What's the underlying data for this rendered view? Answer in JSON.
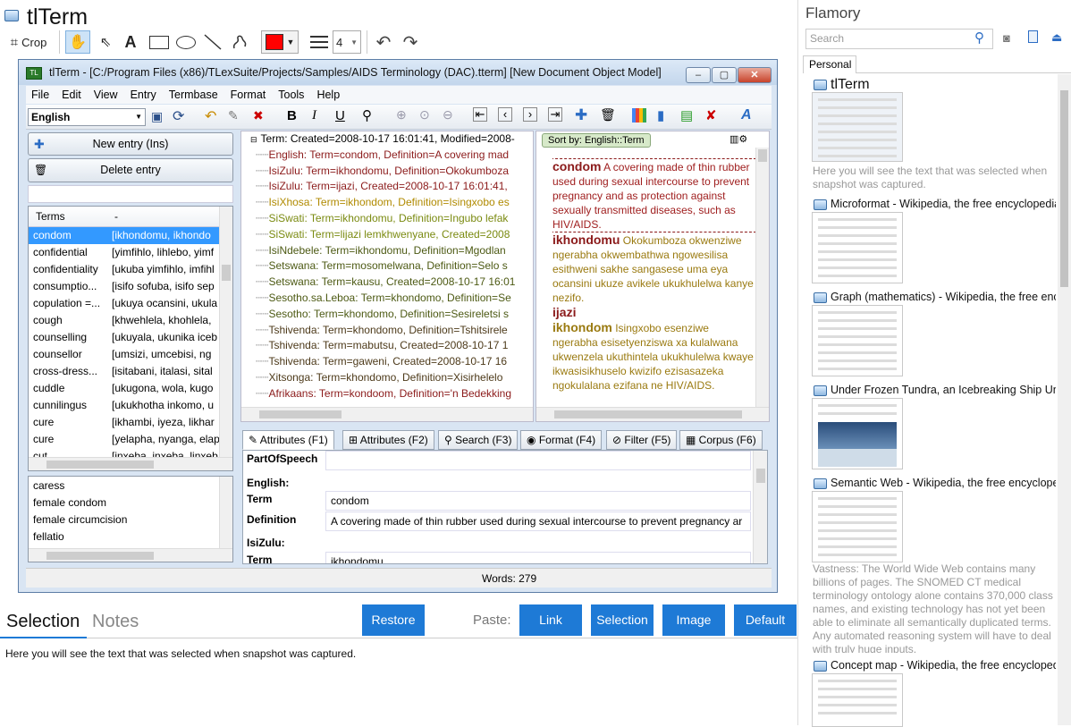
{
  "left": {
    "app_title": "tlTerm",
    "toolbar": {
      "crop_label": "Crop",
      "line_width_value": "4"
    }
  },
  "window": {
    "title": "tlTerm - [C:/Program Files (x86)/TLexSuite/Projects/Samples/AIDS Terminology (DAC).tterm] [New Document Object Model]",
    "menu": [
      "File",
      "Edit",
      "View",
      "Entry",
      "Termbase",
      "Format",
      "Tools",
      "Help"
    ],
    "language_select": "English",
    "new_entry": "New entry (Ins)",
    "delete_entry": "Delete entry",
    "terms_header": [
      "Terms",
      "-"
    ],
    "terms": [
      [
        "condom",
        "[ikhondomu, ikhondo"
      ],
      [
        "confidential",
        "[yimfihlo, lihlebo, yimf"
      ],
      [
        "confidentiality",
        "[ukuba yimfihlo, imfihl"
      ],
      [
        "consumptio...",
        "[isifo sofuba, isifo sep"
      ],
      [
        "copulation =...",
        "[ukuya ocansini, ukula"
      ],
      [
        "cough",
        "[khwehlela, khohlela,"
      ],
      [
        "counselling",
        "[ukuyala, ukunika iceb"
      ],
      [
        "counsellor",
        "[umsizi, umcebisi, ng"
      ],
      [
        "cross-dress...",
        "[isitabani, italasi, sital"
      ],
      [
        "cuddle",
        "[ukugona, wola, kugo"
      ],
      [
        "cunnilingus",
        "[ukukhotha inkomo, u"
      ],
      [
        "cure",
        "[ikhambi, iyeza, likhar"
      ],
      [
        "cure",
        "[yelapha, nyanga, elap"
      ],
      [
        "cut",
        "[inxeba, inxeba, linxeb"
      ]
    ],
    "related_terms": [
      "caress",
      "female condom",
      "female circumcision",
      "fellatio"
    ],
    "tree_root": "Term:  Created=2008-10-17 16:01:41, Modified=2008-",
    "tree_rows": [
      {
        "text": "English:  Term=condom, Definition=A covering mad",
        "color": "#8b1a1a"
      },
      {
        "text": "IsiZulu:  Term=ikhondomu, Definition=Okokumboza",
        "color": "#8b1a1a"
      },
      {
        "text": "IsiZulu:  Term=ijazi, Created=2008-10-17 16:01:41,",
        "color": "#8b1a1a"
      },
      {
        "text": "IsiXhosa:  Term=ikhondom, Definition=Isingxobo es",
        "color": "#b08a00"
      },
      {
        "text": "SiSwati:  Term=ikhondomu, Definition=Ingubo lefak",
        "color": "#7a8a10"
      },
      {
        "text": "SiSwati:  Term=lijazi lemkhwenyane, Created=2008",
        "color": "#7a8a10"
      },
      {
        "text": "IsiNdebele:  Term=ikhondomu, Definition=Mgodlan",
        "color": "#4d5a14"
      },
      {
        "text": "Setswana:  Term=mosomelwana, Definition=Selo s",
        "color": "#4d5a14"
      },
      {
        "text": "Setswana:  Term=kausu, Created=2008-10-17 16:01",
        "color": "#4d5a14"
      },
      {
        "text": "Sesotho.sa.Leboa:  Term=khondomo, Definition=Se",
        "color": "#4d5a14"
      },
      {
        "text": "Sesotho:  Term=khondomo, Definition=Sesireletsi s",
        "color": "#4d5a14"
      },
      {
        "text": "Tshivenda:  Term=khondomo, Definition=Tshitsirele",
        "color": "#4d3a1a"
      },
      {
        "text": "Tshivenda:  Term=mabutsu, Created=2008-10-17 1",
        "color": "#4d3a1a"
      },
      {
        "text": "Tshivenda:  Term=gaweni, Created=2008-10-17 16",
        "color": "#4d3a1a"
      },
      {
        "text": "Xitsonga:  Term=khondomo, Definition=Xisirhelelo",
        "color": "#4d3a1a"
      },
      {
        "text": "Afrikaans:  Term=kondoom, Definition='n Bedekking",
        "color": "#8b1a1a"
      }
    ],
    "sort_label": "Sort by: English::Term",
    "preview": {
      "h1": "condom",
      "p1": " A covering made of thin rubber used during sexual intercourse to prevent pregnancy and as protection against sexually transmitted diseases, such as HIV/AIDS.",
      "h2": "ikhondomu",
      "p2": " Okokumboza okwenziwe ngerabha okwembathwa ngowesilisa esithweni sakhe sangasese uma eya ocansini ukuze avikele ukukhulelwa kanye nezifo.",
      "h3": "ijazi",
      "h4": "ikhondom",
      "p4": " Isingxobo esenziwe ngerabha esisetyenziswa xa kulalwana ukwenzela ukuthintela ukukhulelwa kwaye ikwasisikhuselo kwizifo ezisasazeka ngokulalana ezifana ne HIV/AIDS."
    },
    "tabs": [
      "Attributes (F1)",
      "Attributes (F2)",
      "Search (F3)",
      "Format (F4)",
      "Filter (F5)",
      "Corpus (F6)"
    ],
    "attrs": {
      "pos_label": "PartOfSpeech",
      "english_label": "English:",
      "term_label": "Term",
      "term_value": "condom",
      "def_label": "Definition",
      "def_value": "A covering made of thin rubber used during sexual intercourse to prevent pregnancy ar",
      "isizulu_label": "IsiZulu:",
      "term2_label": "Term",
      "term2_value": "ikhondomu"
    },
    "status": "Words: 279"
  },
  "bottom": {
    "tab_selection": "Selection",
    "tab_notes": "Notes",
    "restore": "Restore",
    "paste_label": "Paste:",
    "paste_buttons": [
      "Link",
      "Selection",
      "Image",
      "Default"
    ],
    "selection_text": "Here you will see the text that was selected when snapshot was captured."
  },
  "right": {
    "title": "Flamory",
    "search_placeholder": "Search",
    "tab_personal": "Personal",
    "items": [
      {
        "title": "tlTerm",
        "desc": "Here you will see the text that was selected when snapshot was captured."
      },
      {
        "title": "Microformat - Wikipedia, the free encyclopedia"
      },
      {
        "title": "Graph (mathematics) - Wikipedia, the free ency"
      },
      {
        "title": "Under Frozen Tundra, an Icebreaking Ship Unco"
      },
      {
        "title": "Semantic Web - Wikipedia, the free encycloped",
        "desc": "Vastness: The World Wide Web contains many billions of pages. The SNOMED CT medical terminology ontology alone contains 370,000 class names, and existing technology has not yet been able to eliminate all semantically duplicated terms. Any automated reasoning system will have to deal with truly huge inputs."
      },
      {
        "title": "Concept map - Wikipedia, the free encyclopedi"
      }
    ]
  }
}
